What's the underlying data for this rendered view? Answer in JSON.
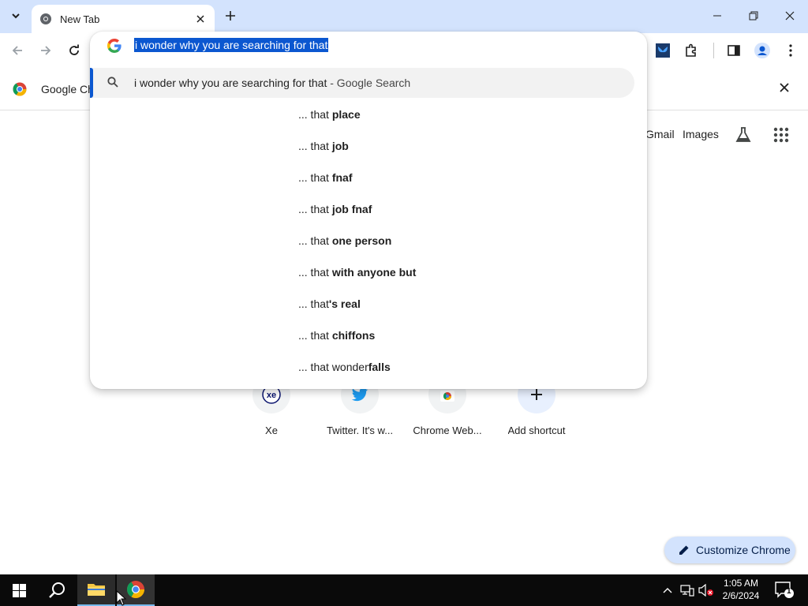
{
  "browser": {
    "tab_title": "New Tab",
    "infobar_text": "Google Ch"
  },
  "omnibox": {
    "input_text": "i wonder why you are searching for that",
    "selected_suggestion": {
      "main": "i wonder why you are searching for that",
      "suffix": " - Google Search"
    },
    "tail_prefix": "... that",
    "tail_suggestions": [
      {
        "plain": "",
        "bold": "place"
      },
      {
        "plain": "",
        "bold": "job"
      },
      {
        "plain": "",
        "bold": "fnaf"
      },
      {
        "plain": "",
        "bold": "job fnaf"
      },
      {
        "plain": "",
        "bold": "one person"
      },
      {
        "plain": "",
        "bold": "with anyone but"
      },
      {
        "plain": "",
        "bold": "'s real"
      },
      {
        "plain": "",
        "bold": "chiffons"
      },
      {
        "plain": " wonder",
        "bold": "falls"
      }
    ]
  },
  "ntp": {
    "header_links": {
      "gmail": "Gmail",
      "images": "Images"
    },
    "shortcuts": [
      {
        "label": "Xe",
        "icon": "xe-icon"
      },
      {
        "label": "Twitter. It's w...",
        "icon": "twitter-icon"
      },
      {
        "label": "Chrome Web...",
        "icon": "chrome-web-store-icon"
      },
      {
        "label": "Add shortcut",
        "icon": "plus-icon"
      }
    ],
    "customize_label": "Customize Chrome"
  },
  "taskbar": {
    "time": "1:05 AM",
    "date": "2/6/2024",
    "notification_count": "1"
  },
  "colors": {
    "accent": "#0b57d0",
    "titlebar": "#d3e3fd",
    "taskbar": "#0a0a0a"
  }
}
